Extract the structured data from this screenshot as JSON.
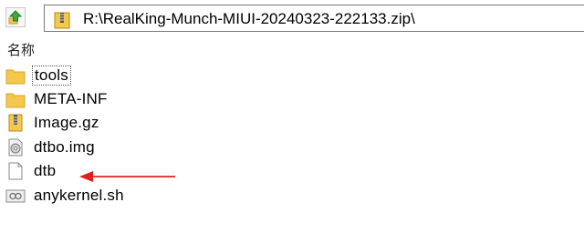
{
  "address_bar": {
    "path": "R:\\RealKing-Munch-MIUI-20240323-222133.zip\\"
  },
  "list_header": {
    "name_column": "名称"
  },
  "items": [
    {
      "label": "tools",
      "icon": "folder-icon",
      "focused": true
    },
    {
      "label": "META-INF",
      "icon": "folder-icon"
    },
    {
      "label": "Image.gz",
      "icon": "archive-file-icon"
    },
    {
      "label": "dtbo.img",
      "icon": "disk-image-file-icon"
    },
    {
      "label": "dtb",
      "icon": "blank-file-icon"
    },
    {
      "label": "anykernel.sh",
      "icon": "script-file-icon"
    }
  ],
  "annotation": {
    "icon": "red-arrow-icon",
    "color": "#e02020"
  },
  "colors": {
    "folder": "#f4c84a",
    "arrow": "#e02020"
  }
}
